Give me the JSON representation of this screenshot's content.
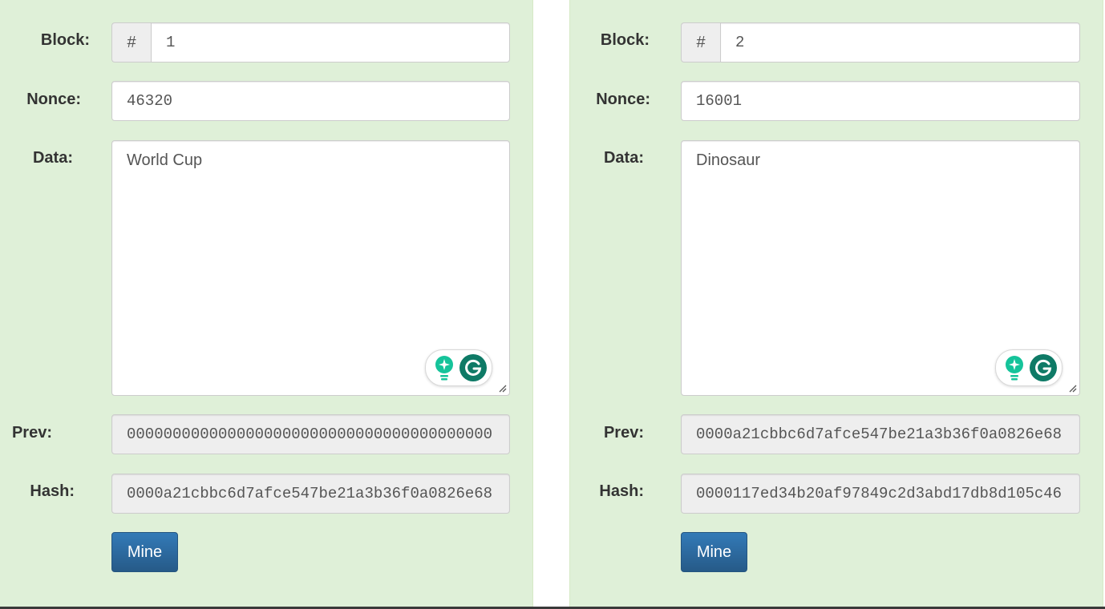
{
  "labels": {
    "block": "Block:",
    "nonce": "Nonce:",
    "data": "Data:",
    "prev": "Prev:",
    "hash": "Hash:"
  },
  "addon_symbol": "#",
  "mine_label": "Mine",
  "blocks": [
    {
      "number": "1",
      "nonce": "46320",
      "data": "World Cup",
      "prev": "0000000000000000000000000000000000000000",
      "hash": "0000a21cbbc6d7afce547be21a3b36f0a0826e68"
    },
    {
      "number": "2",
      "nonce": "16001",
      "data": "Dinosaur",
      "prev": "0000a21cbbc6d7afce547be21a3b36f0a0826e68",
      "hash": "0000117ed34b20af97849c2d3abd17db8d105c46"
    }
  ],
  "colors": {
    "panel_bg": "#dff0d8",
    "button_bg": "#337ab7",
    "grammarly_green": "#15c39a",
    "grammarly_dark": "#0e7a66"
  },
  "icons": [
    "hash-symbol",
    "grammarly-bulb-icon",
    "grammarly-logo-icon",
    "resize-handle-icon"
  ]
}
